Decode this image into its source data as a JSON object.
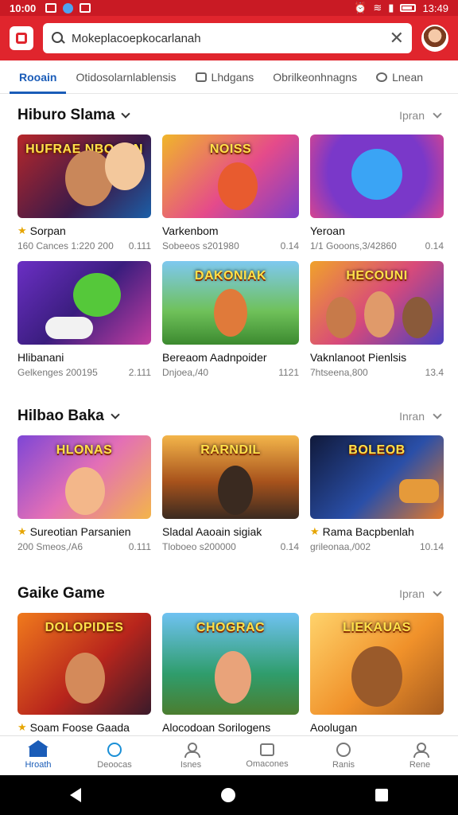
{
  "status_bar": {
    "time": "10:00",
    "clock_right": "13:49"
  },
  "header": {
    "search_value": "Mokeplacoepkocarlanah",
    "brand_color": "#e0252d"
  },
  "tabs": [
    {
      "label": "Rooain",
      "icon": "home-icon",
      "active": true
    },
    {
      "label": "Otidosolarnlablensis",
      "icon": "",
      "active": false
    },
    {
      "label": "Lhdgans",
      "icon": "house-icon",
      "active": false
    },
    {
      "label": "Obrilkeonhnagns",
      "icon": "",
      "active": false
    },
    {
      "label": "Lnean",
      "icon": "chat-icon",
      "active": false
    }
  ],
  "sections": [
    {
      "title": "Hiburo Slama",
      "see_all": "Ipran",
      "cards": [
        {
          "thumb_text": "HUFRAE NBOOSN",
          "title": "Sorpan",
          "meta_left": "160 Cances 1:220 200",
          "meta_right": "0.111",
          "starred": true
        },
        {
          "thumb_text": "NOISS",
          "title": "Varkenbom",
          "meta_left": "Sobeeos s201980",
          "meta_right": "0.14",
          "starred": false
        },
        {
          "thumb_text": "",
          "title": "Yeroan",
          "meta_left": "1/1 Gooons,3/42860",
          "meta_right": "0.14",
          "starred": false
        },
        {
          "thumb_text": "",
          "title": "Hlibanani",
          "meta_left": "Gelkenges 200195",
          "meta_right": "2.111",
          "starred": false
        },
        {
          "thumb_text": "DAKONIAK",
          "title": "Bereaom Aadnpoider",
          "meta_left": "Dnjoea,/40",
          "meta_right": "1121",
          "starred": false
        },
        {
          "thumb_text": "HECOUNI",
          "title": "Vaknlanoot Pienlsis",
          "meta_left": "7htseena,800",
          "meta_right": "13.4",
          "starred": false
        }
      ]
    },
    {
      "title": "Hilbao Baka",
      "see_all": "Inran",
      "cards": [
        {
          "thumb_text": "HLONAS",
          "title": "Sureotian Parsanien",
          "meta_left": "200 Smeos,/A6",
          "meta_right": "0.111",
          "starred": true
        },
        {
          "thumb_text": "RARNDIL",
          "title": "Sladal Aaoain sigiak",
          "meta_left": "Tloboeo s200000",
          "meta_right": "0.14",
          "starred": false
        },
        {
          "thumb_text": "BOLEOB",
          "title": "Rama Bacpbenlah",
          "meta_left": "grileonaa,/002",
          "meta_right": "10.14",
          "starred": true
        }
      ]
    },
    {
      "title": "Gaike Game",
      "see_all": "Ipran",
      "cards": [
        {
          "thumb_text": "DOLOPIDES",
          "title": "Soam Foose Gaada",
          "meta_left": "",
          "meta_right": "",
          "starred": true
        },
        {
          "thumb_text": "CHOGRAC",
          "title": "Alocodoan Sorilogens",
          "meta_left": "",
          "meta_right": "",
          "starred": false
        },
        {
          "thumb_text": "LIEKAUAS",
          "title": "Aoolugan",
          "meta_left": "",
          "meta_right": "",
          "starred": false
        }
      ]
    }
  ],
  "bottom_nav": [
    {
      "label": "Hroath",
      "icon": "home-icon",
      "active": true
    },
    {
      "label": "Deoocas",
      "icon": "chat-icon",
      "active": false
    },
    {
      "label": "Isnes",
      "icon": "people-icon",
      "active": false
    },
    {
      "label": "Omacones",
      "icon": "mail-icon",
      "active": false
    },
    {
      "label": "Ranis",
      "icon": "search-icon",
      "active": false
    },
    {
      "label": "Rene",
      "icon": "profile-icon",
      "active": false
    }
  ]
}
